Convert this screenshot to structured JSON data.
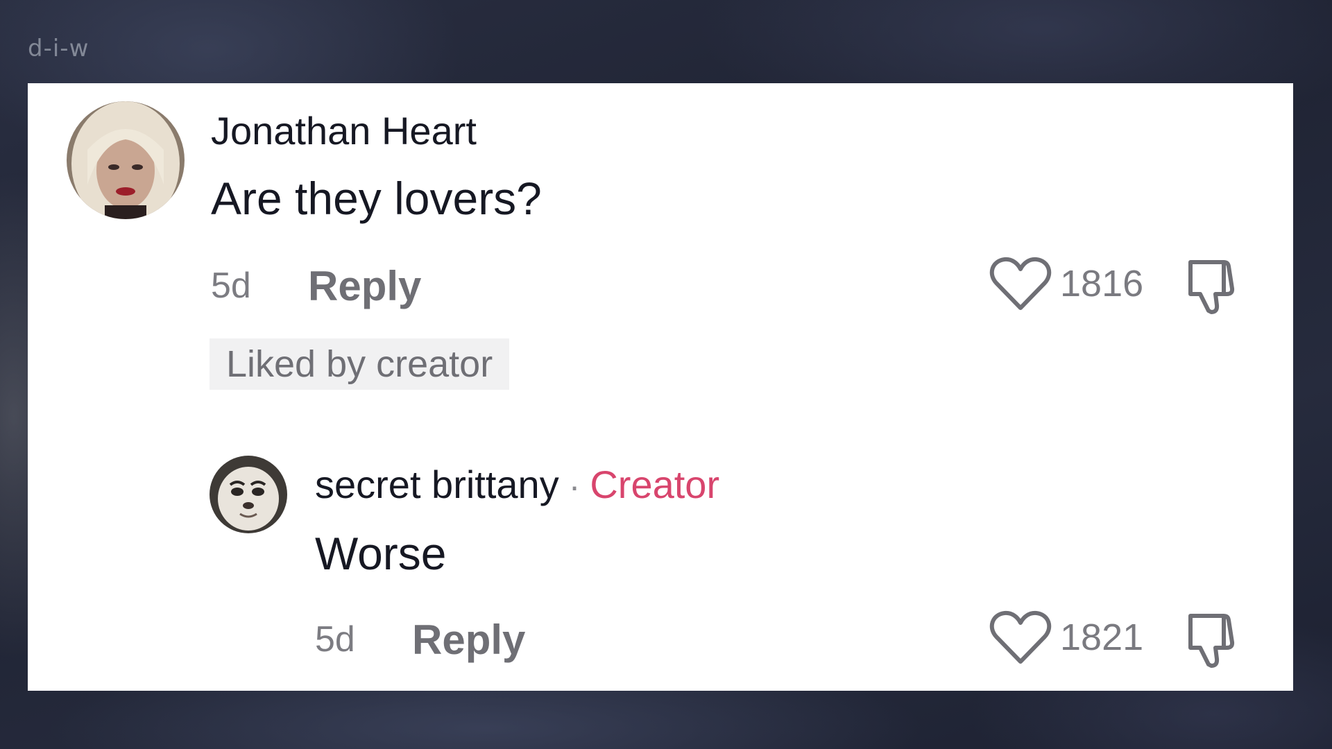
{
  "watermark": "d-i-w",
  "comments": [
    {
      "username": "Jonathan Heart",
      "text": "Are they lovers?",
      "age": "5d",
      "reply_label": "Reply",
      "like_count": "1816",
      "badge": "Liked by creator"
    },
    {
      "username": "secret brittany",
      "separator": "·",
      "role_tag": "Creator",
      "text": "Worse",
      "age": "5d",
      "reply_label": "Reply",
      "like_count": "1821"
    }
  ],
  "colors": {
    "card_bg": "#ffffff",
    "text_primary": "#161823",
    "text_secondary": "#7c7c82",
    "creator_accent": "#d8456d",
    "badge_bg": "#f1f1f2"
  },
  "icons": {
    "like": "heart-outline-icon",
    "dislike": "thumbs-down-icon"
  }
}
